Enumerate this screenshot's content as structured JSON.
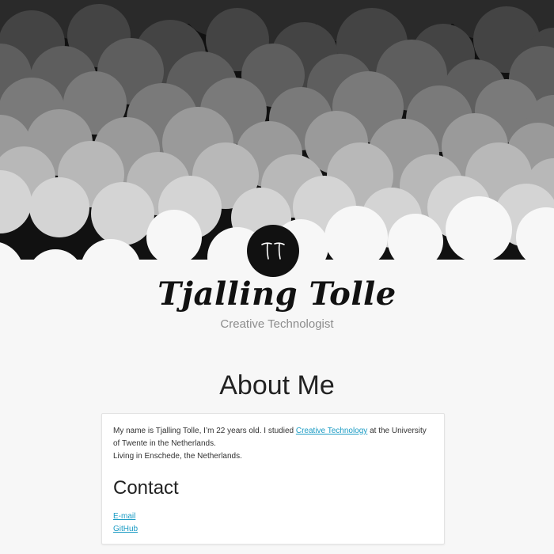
{
  "header": {
    "logo_alt": "TT",
    "name": "Tjalling Tolle",
    "tagline": "Creative Technologist"
  },
  "about": {
    "title": "About Me",
    "text_before_link": "My name is Tjalling Tolle, I’m 22 years old. I studied ",
    "link_label": "Creative Technology",
    "text_after_link": " at the University of Twente in the Netherlands.",
    "location": "Living in Enschede, the Netherlands."
  },
  "contact": {
    "title": "Contact",
    "links": [
      {
        "label": "E-mail"
      },
      {
        "label": "GitHub"
      }
    ]
  },
  "colors": {
    "background": "#f7f7f7",
    "link": "#1a9bc4",
    "logo": "#111111",
    "tagline": "#8c8c8c"
  }
}
